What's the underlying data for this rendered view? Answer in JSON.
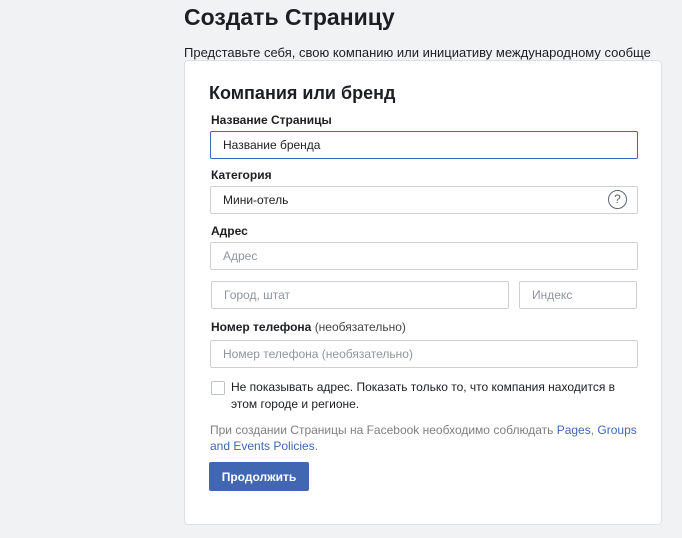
{
  "page": {
    "title": "Создать Страницу",
    "subtitle": "Представьте себя, свою компанию или инициативу международному сообще"
  },
  "card": {
    "title": "Компания или бренд",
    "page_name": {
      "label": "Название Страницы",
      "value": "Название бренда"
    },
    "category": {
      "label": "Категория",
      "value": "Мини-отель",
      "help_icon": "?"
    },
    "address": {
      "label": "Адрес",
      "address_placeholder": "Адрес",
      "city_placeholder": "Город, штат",
      "zip_placeholder": "Индекс"
    },
    "phone": {
      "label": "Номер телефона",
      "label_optional": "(необязательно)",
      "placeholder": "Номер телефона (необязательно)"
    },
    "hide_address": {
      "checked": false,
      "label": "Не показывать адрес. Показать только то, что компания находится в этом городе и регионе."
    },
    "policy": {
      "text": "При создании Страницы на Facebook необходимо соблюдать ",
      "link1": "Pages",
      "sep": ", ",
      "link2": "Groups and Events Policies",
      "end": "."
    },
    "continue_label": "Продолжить"
  },
  "colors": {
    "accent": "#4267b2",
    "background": "#f1f2f4",
    "card": "#ffffff"
  }
}
